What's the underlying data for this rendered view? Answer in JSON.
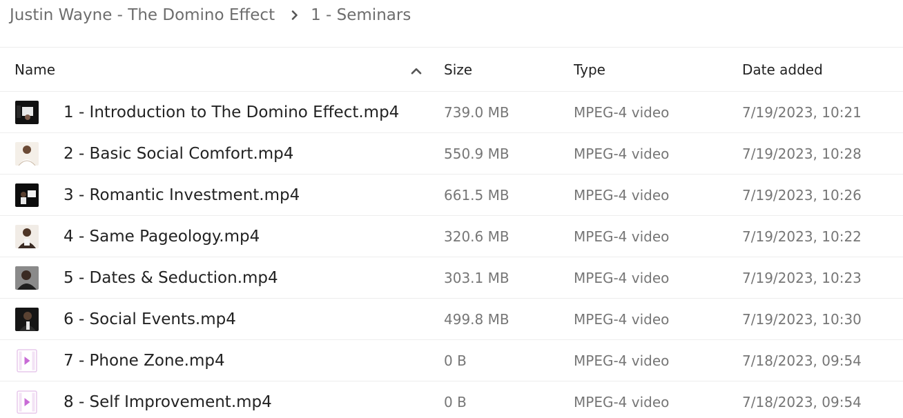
{
  "breadcrumb": {
    "parent": "Justin Wayne - The Domino Effect",
    "current": "1 - Seminars"
  },
  "table": {
    "columns": {
      "name": "Name",
      "size": "Size",
      "type": "Type",
      "date": "Date added"
    },
    "sort": {
      "column": "name",
      "direction": "ascending",
      "icon": "chevron-up-icon"
    },
    "rows": [
      {
        "name": "1 - Introduction to The Domino Effect.mp4",
        "size": "739.0 MB",
        "type": "MPEG-4 video",
        "date": "7/19/2023, 10:21",
        "preview": "video-thumbnail"
      },
      {
        "name": "2 - Basic Social Comfort.mp4",
        "size": "550.9 MB",
        "type": "MPEG-4 video",
        "date": "7/19/2023, 10:28",
        "preview": "video-thumbnail"
      },
      {
        "name": "3 - Romantic Investment.mp4",
        "size": "661.5 MB",
        "type": "MPEG-4 video",
        "date": "7/19/2023, 10:26",
        "preview": "video-thumbnail"
      },
      {
        "name": "4 - Same Pageology.mp4",
        "size": "320.6 MB",
        "type": "MPEG-4 video",
        "date": "7/19/2023, 10:22",
        "preview": "video-thumbnail"
      },
      {
        "name": "5 - Dates & Seduction.mp4",
        "size": "303.1 MB",
        "type": "MPEG-4 video",
        "date": "7/19/2023, 10:23",
        "preview": "video-thumbnail"
      },
      {
        "name": "6 - Social Events.mp4",
        "size": "499.8 MB",
        "type": "MPEG-4 video",
        "date": "7/19/2023, 10:30",
        "preview": "video-thumbnail"
      },
      {
        "name": "7 - Phone Zone.mp4",
        "size": "0 B",
        "type": "MPEG-4 video",
        "date": "7/18/2023, 09:54",
        "preview": "video-file-icon"
      },
      {
        "name": "8 - Self Improvement.mp4",
        "size": "0 B",
        "type": "MPEG-4 video",
        "date": "7/18/2023, 09:54",
        "preview": "video-file-icon"
      }
    ]
  },
  "colors": {
    "text_primary": "#222222",
    "text_secondary": "#767676",
    "breadcrumb_text": "#6d6d6d",
    "row_divider": "#ededed",
    "video_icon_accent": "#c86bd6"
  }
}
